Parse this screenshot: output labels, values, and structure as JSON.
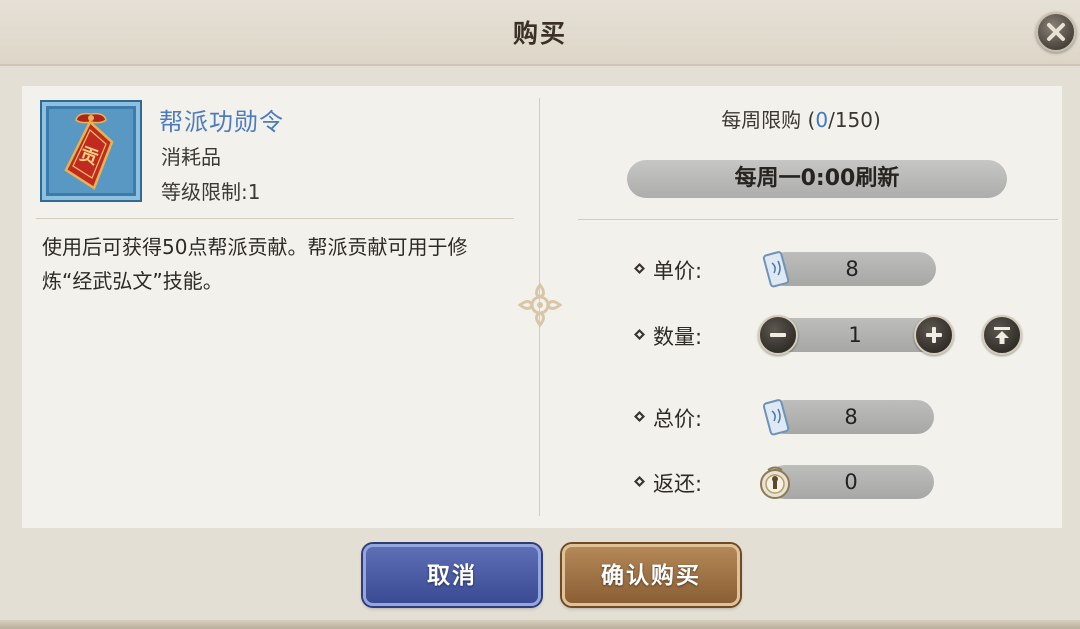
{
  "dialog": {
    "title": "购买"
  },
  "item": {
    "name": "帮派功勋令",
    "type": "消耗品",
    "level_label": "等级限制:",
    "level_value": "1",
    "description": "使用后可获得50点帮派贡献。帮派贡献可用于修炼“经武弘文”技能。",
    "icon": "guild-merit-token-icon",
    "icon_glyph": "贡"
  },
  "limit": {
    "label": "每周限购 (",
    "current": "0",
    "max": "/150)"
  },
  "refresh": {
    "text": "每周一0:00刷新"
  },
  "rows": {
    "unit_price": {
      "label": "单价:",
      "value": "8",
      "currency_icon": "scroll-currency-icon"
    },
    "quantity": {
      "label": "数量:",
      "value": "1"
    },
    "total_price": {
      "label": "总价:",
      "value": "8",
      "currency_icon": "scroll-currency-icon"
    },
    "refund": {
      "label": "返还:",
      "value": "0",
      "currency_icon": "bell-coin-icon"
    }
  },
  "buttons": {
    "cancel": "取消",
    "confirm": "确认购买"
  },
  "colors": {
    "item_name": "#4b7cc0",
    "limit_current": "#3d79c6",
    "cancel_button": "#3a4a93",
    "confirm_button": "#8a5f34"
  }
}
